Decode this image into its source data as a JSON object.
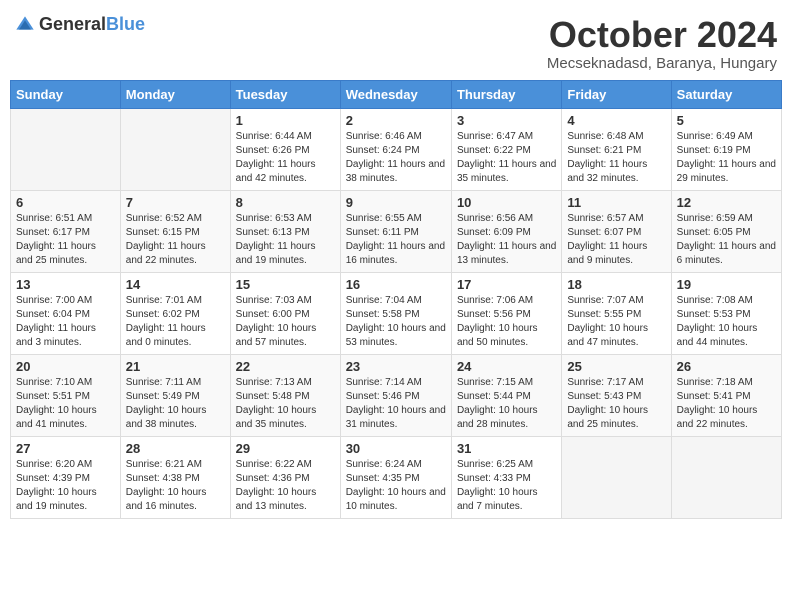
{
  "header": {
    "logo": {
      "general": "General",
      "blue": "Blue"
    },
    "title": "October 2024",
    "subtitle": "Mecseknadasd, Baranya, Hungary"
  },
  "days_of_week": [
    "Sunday",
    "Monday",
    "Tuesday",
    "Wednesday",
    "Thursday",
    "Friday",
    "Saturday"
  ],
  "weeks": [
    [
      {
        "day": "",
        "info": ""
      },
      {
        "day": "",
        "info": ""
      },
      {
        "day": "1",
        "info": "Sunrise: 6:44 AM\nSunset: 6:26 PM\nDaylight: 11 hours and 42 minutes."
      },
      {
        "day": "2",
        "info": "Sunrise: 6:46 AM\nSunset: 6:24 PM\nDaylight: 11 hours and 38 minutes."
      },
      {
        "day": "3",
        "info": "Sunrise: 6:47 AM\nSunset: 6:22 PM\nDaylight: 11 hours and 35 minutes."
      },
      {
        "day": "4",
        "info": "Sunrise: 6:48 AM\nSunset: 6:21 PM\nDaylight: 11 hours and 32 minutes."
      },
      {
        "day": "5",
        "info": "Sunrise: 6:49 AM\nSunset: 6:19 PM\nDaylight: 11 hours and 29 minutes."
      }
    ],
    [
      {
        "day": "6",
        "info": "Sunrise: 6:51 AM\nSunset: 6:17 PM\nDaylight: 11 hours and 25 minutes."
      },
      {
        "day": "7",
        "info": "Sunrise: 6:52 AM\nSunset: 6:15 PM\nDaylight: 11 hours and 22 minutes."
      },
      {
        "day": "8",
        "info": "Sunrise: 6:53 AM\nSunset: 6:13 PM\nDaylight: 11 hours and 19 minutes."
      },
      {
        "day": "9",
        "info": "Sunrise: 6:55 AM\nSunset: 6:11 PM\nDaylight: 11 hours and 16 minutes."
      },
      {
        "day": "10",
        "info": "Sunrise: 6:56 AM\nSunset: 6:09 PM\nDaylight: 11 hours and 13 minutes."
      },
      {
        "day": "11",
        "info": "Sunrise: 6:57 AM\nSunset: 6:07 PM\nDaylight: 11 hours and 9 minutes."
      },
      {
        "day": "12",
        "info": "Sunrise: 6:59 AM\nSunset: 6:05 PM\nDaylight: 11 hours and 6 minutes."
      }
    ],
    [
      {
        "day": "13",
        "info": "Sunrise: 7:00 AM\nSunset: 6:04 PM\nDaylight: 11 hours and 3 minutes."
      },
      {
        "day": "14",
        "info": "Sunrise: 7:01 AM\nSunset: 6:02 PM\nDaylight: 11 hours and 0 minutes."
      },
      {
        "day": "15",
        "info": "Sunrise: 7:03 AM\nSunset: 6:00 PM\nDaylight: 10 hours and 57 minutes."
      },
      {
        "day": "16",
        "info": "Sunrise: 7:04 AM\nSunset: 5:58 PM\nDaylight: 10 hours and 53 minutes."
      },
      {
        "day": "17",
        "info": "Sunrise: 7:06 AM\nSunset: 5:56 PM\nDaylight: 10 hours and 50 minutes."
      },
      {
        "day": "18",
        "info": "Sunrise: 7:07 AM\nSunset: 5:55 PM\nDaylight: 10 hours and 47 minutes."
      },
      {
        "day": "19",
        "info": "Sunrise: 7:08 AM\nSunset: 5:53 PM\nDaylight: 10 hours and 44 minutes."
      }
    ],
    [
      {
        "day": "20",
        "info": "Sunrise: 7:10 AM\nSunset: 5:51 PM\nDaylight: 10 hours and 41 minutes."
      },
      {
        "day": "21",
        "info": "Sunrise: 7:11 AM\nSunset: 5:49 PM\nDaylight: 10 hours and 38 minutes."
      },
      {
        "day": "22",
        "info": "Sunrise: 7:13 AM\nSunset: 5:48 PM\nDaylight: 10 hours and 35 minutes."
      },
      {
        "day": "23",
        "info": "Sunrise: 7:14 AM\nSunset: 5:46 PM\nDaylight: 10 hours and 31 minutes."
      },
      {
        "day": "24",
        "info": "Sunrise: 7:15 AM\nSunset: 5:44 PM\nDaylight: 10 hours and 28 minutes."
      },
      {
        "day": "25",
        "info": "Sunrise: 7:17 AM\nSunset: 5:43 PM\nDaylight: 10 hours and 25 minutes."
      },
      {
        "day": "26",
        "info": "Sunrise: 7:18 AM\nSunset: 5:41 PM\nDaylight: 10 hours and 22 minutes."
      }
    ],
    [
      {
        "day": "27",
        "info": "Sunrise: 6:20 AM\nSunset: 4:39 PM\nDaylight: 10 hours and 19 minutes."
      },
      {
        "day": "28",
        "info": "Sunrise: 6:21 AM\nSunset: 4:38 PM\nDaylight: 10 hours and 16 minutes."
      },
      {
        "day": "29",
        "info": "Sunrise: 6:22 AM\nSunset: 4:36 PM\nDaylight: 10 hours and 13 minutes."
      },
      {
        "day": "30",
        "info": "Sunrise: 6:24 AM\nSunset: 4:35 PM\nDaylight: 10 hours and 10 minutes."
      },
      {
        "day": "31",
        "info": "Sunrise: 6:25 AM\nSunset: 4:33 PM\nDaylight: 10 hours and 7 minutes."
      },
      {
        "day": "",
        "info": ""
      },
      {
        "day": "",
        "info": ""
      }
    ]
  ]
}
